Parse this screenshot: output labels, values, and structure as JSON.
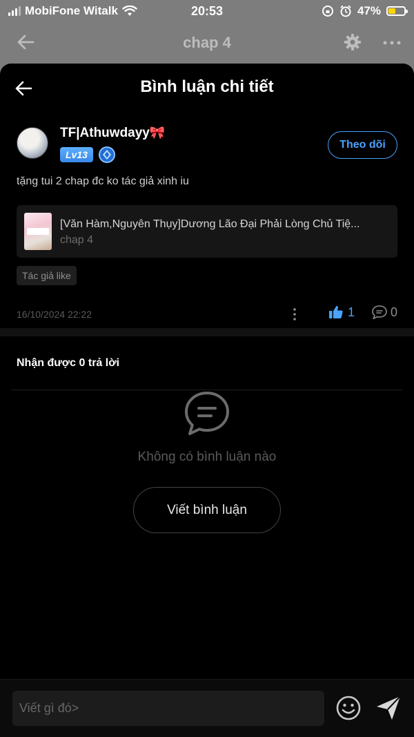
{
  "status_bar": {
    "carrier": "MobiFone Witalk",
    "time": "20:53",
    "battery": "47%",
    "battery_level": 0.47
  },
  "background_nav": {
    "title": "chap 4"
  },
  "sheet": {
    "title": "Bình luận chi tiết"
  },
  "comment": {
    "author": "TF|Athuwdayy",
    "author_emoji": "🎀",
    "level": "Lv13",
    "follow_label": "Theo dõi",
    "text": "tặng tui 2 chap đc ko tác giả xinh iu",
    "chapter": {
      "title": "[Văn Hàm,Nguyên Thụy]Dương Lão Đại Phải Lòng Chủ Tiệ...",
      "subtitle": "chap 4"
    },
    "tag": "Tác giả like",
    "timestamp": "16/10/2024 22:22",
    "likes": "1",
    "replies": "0"
  },
  "replies_section": {
    "title": "Nhận được 0 trả lời",
    "empty_text": "Không có bình luận nào",
    "write_button": "Viết bình luận"
  },
  "input_bar": {
    "placeholder": "Viết gì đó>"
  },
  "colors": {
    "accent_blue": "#4aa3ff",
    "battery_yellow": "#ffd60a"
  }
}
